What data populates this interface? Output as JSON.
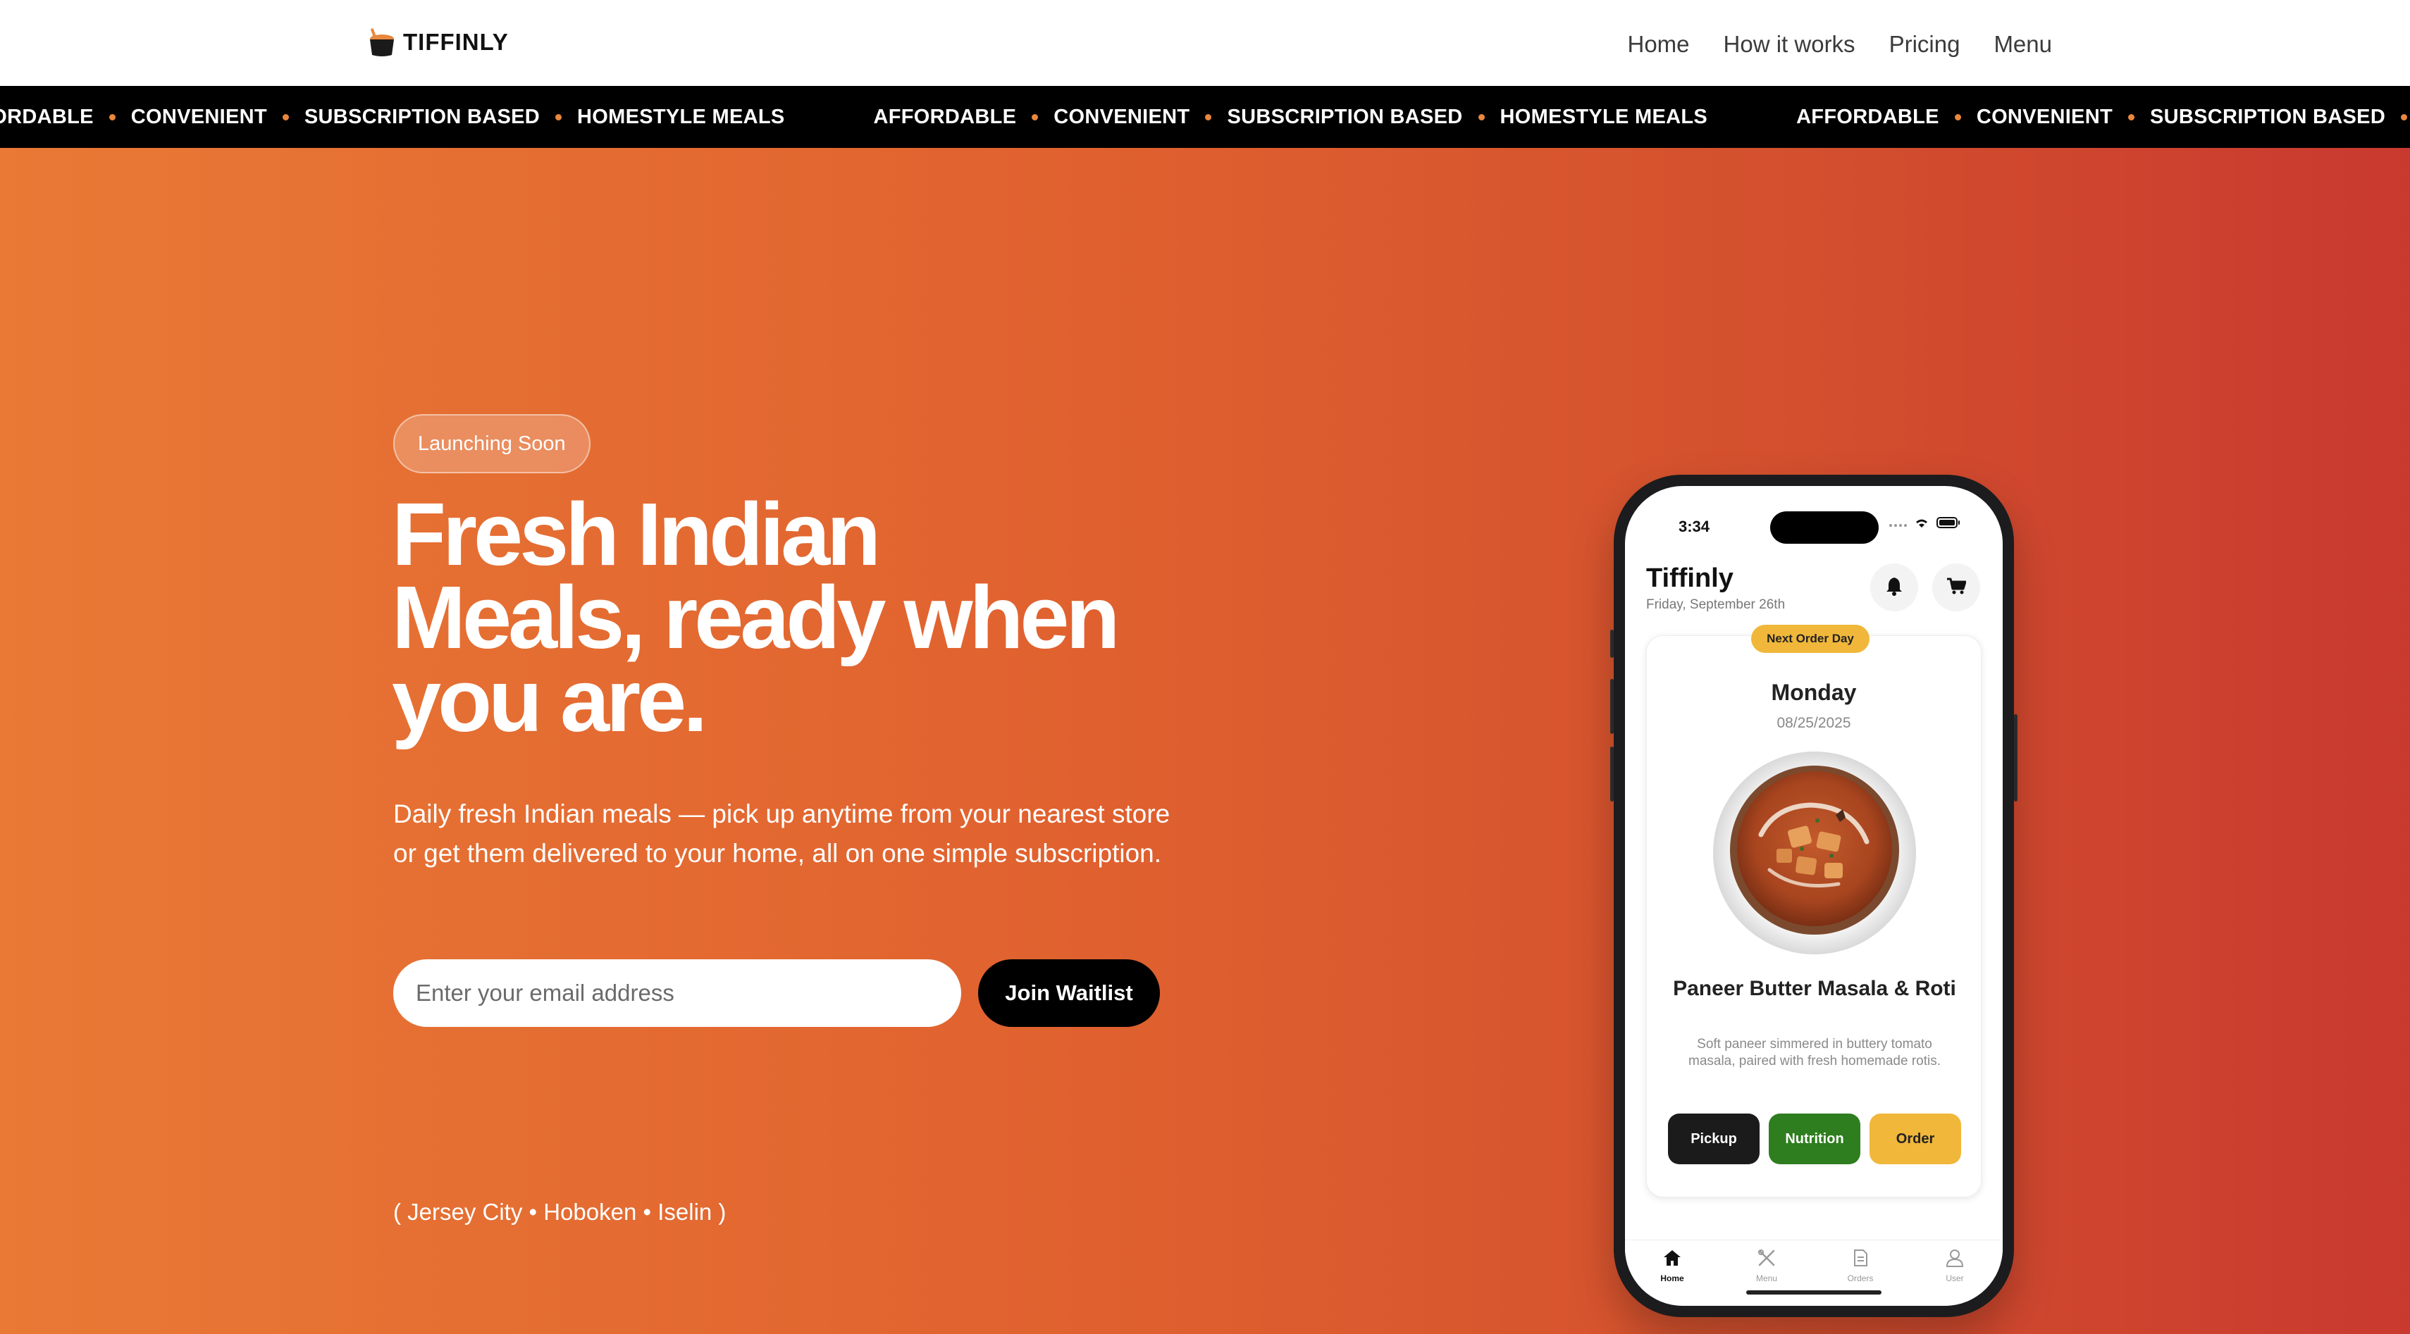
{
  "brand": {
    "name": "TIFFINLY"
  },
  "nav": [
    {
      "label": "Home"
    },
    {
      "label": "How it works"
    },
    {
      "label": "Pricing"
    },
    {
      "label": "Menu"
    }
  ],
  "marquee": {
    "items": [
      "AFFORDABLE",
      "CONVENIENT",
      "SUBSCRIPTION BASED",
      "HOMESTYLE MEALS"
    ]
  },
  "hero": {
    "badge": "Launching Soon",
    "headline_line1": "Fresh Indian",
    "headline_line2": "Meals, ready when",
    "headline_line3": "you are.",
    "subtext": "Daily fresh Indian meals — pick up anytime from your nearest store or get them delivered to your home, all on one simple subscription.",
    "email_placeholder": "Enter your email address",
    "join_label": "Join Waitlist",
    "locations": "( Jersey City • Hoboken • Iselin )"
  },
  "phone": {
    "time": "3:34",
    "app_title": "Tiffinly",
    "app_date": "Friday, September 26th",
    "card": {
      "pill": "Next Order Day",
      "day": "Monday",
      "date": "08/25/2025",
      "dish_name": "Paneer Butter Masala & Roti",
      "dish_desc": "Soft paneer simmered in buttery tomato masala, paired with fresh homemade rotis.",
      "buttons": [
        {
          "label": "Pickup",
          "bg": "#1b1b1b",
          "fg": "#ffffff"
        },
        {
          "label": "Nutrition",
          "bg": "#2e7d1e",
          "fg": "#ffffff"
        },
        {
          "label": "Order",
          "bg": "#f0b73a",
          "fg": "#222222"
        }
      ]
    },
    "tabs": [
      {
        "label": "Home",
        "icon": "home-icon",
        "active": true
      },
      {
        "label": "Menu",
        "icon": "utensils-icon",
        "active": false
      },
      {
        "label": "Orders",
        "icon": "document-icon",
        "active": false
      },
      {
        "label": "User",
        "icon": "user-icon",
        "active": false
      }
    ]
  },
  "colors": {
    "gradient_start": "#e97935",
    "gradient_end": "#c9392f",
    "marquee_dot": "#e8873d"
  }
}
